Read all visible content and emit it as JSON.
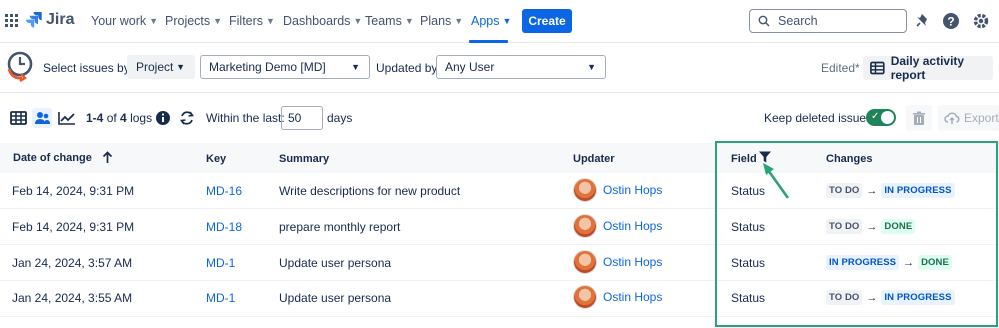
{
  "nav": {
    "brand": "Jira",
    "items": [
      "Your work",
      "Projects",
      "Filters",
      "Dashboards",
      "Teams",
      "Plans",
      "Apps"
    ],
    "create": "Create",
    "search_placeholder": "Search"
  },
  "filters": {
    "select_by_label": "Select issues by:",
    "select_by_value": "Project",
    "project_value": "Marketing Demo [MD]",
    "updated_by_label": "Updated by:",
    "updated_by_value": "Any User",
    "edited": "Edited*",
    "report_button": "Daily activity report"
  },
  "toolbar": {
    "range": "1-4",
    "of": "of",
    "total": "4",
    "logs": "logs",
    "within_label": "Within the last:",
    "days_value": "50",
    "days_unit": "days",
    "keep_deleted": "Keep deleted issues",
    "export": "Export"
  },
  "table": {
    "headers": {
      "date": "Date of change",
      "key": "Key",
      "summary": "Summary",
      "updater": "Updater",
      "field": "Field",
      "changes": "Changes"
    },
    "rows": [
      {
        "date": "Feb 14, 2024, 9:31 PM",
        "key": "MD-16",
        "summary": "Write descriptions for new product",
        "updater": "Ostin Hops",
        "field": "Status",
        "from": "TO DO",
        "to": "IN PROGRESS"
      },
      {
        "date": "Feb 14, 2024, 9:31 PM",
        "key": "MD-18",
        "summary": "prepare monthly report",
        "updater": "Ostin Hops",
        "field": "Status",
        "from": "TO DO",
        "to": "DONE"
      },
      {
        "date": "Jan 24, 2024, 3:57 AM",
        "key": "MD-1",
        "summary": "Update user persona",
        "updater": "Ostin Hops",
        "field": "Status",
        "from": "IN PROGRESS",
        "to": "DONE"
      },
      {
        "date": "Jan 24, 2024, 3:55 AM",
        "key": "MD-1",
        "summary": "Update user persona",
        "updater": "Ostin Hops",
        "field": "Status",
        "from": "TO DO",
        "to": "IN PROGRESS"
      }
    ]
  },
  "colors": {
    "accent": "#0c66e4",
    "highlight": "#2aa37a",
    "toggle_on": "#1f845a"
  }
}
